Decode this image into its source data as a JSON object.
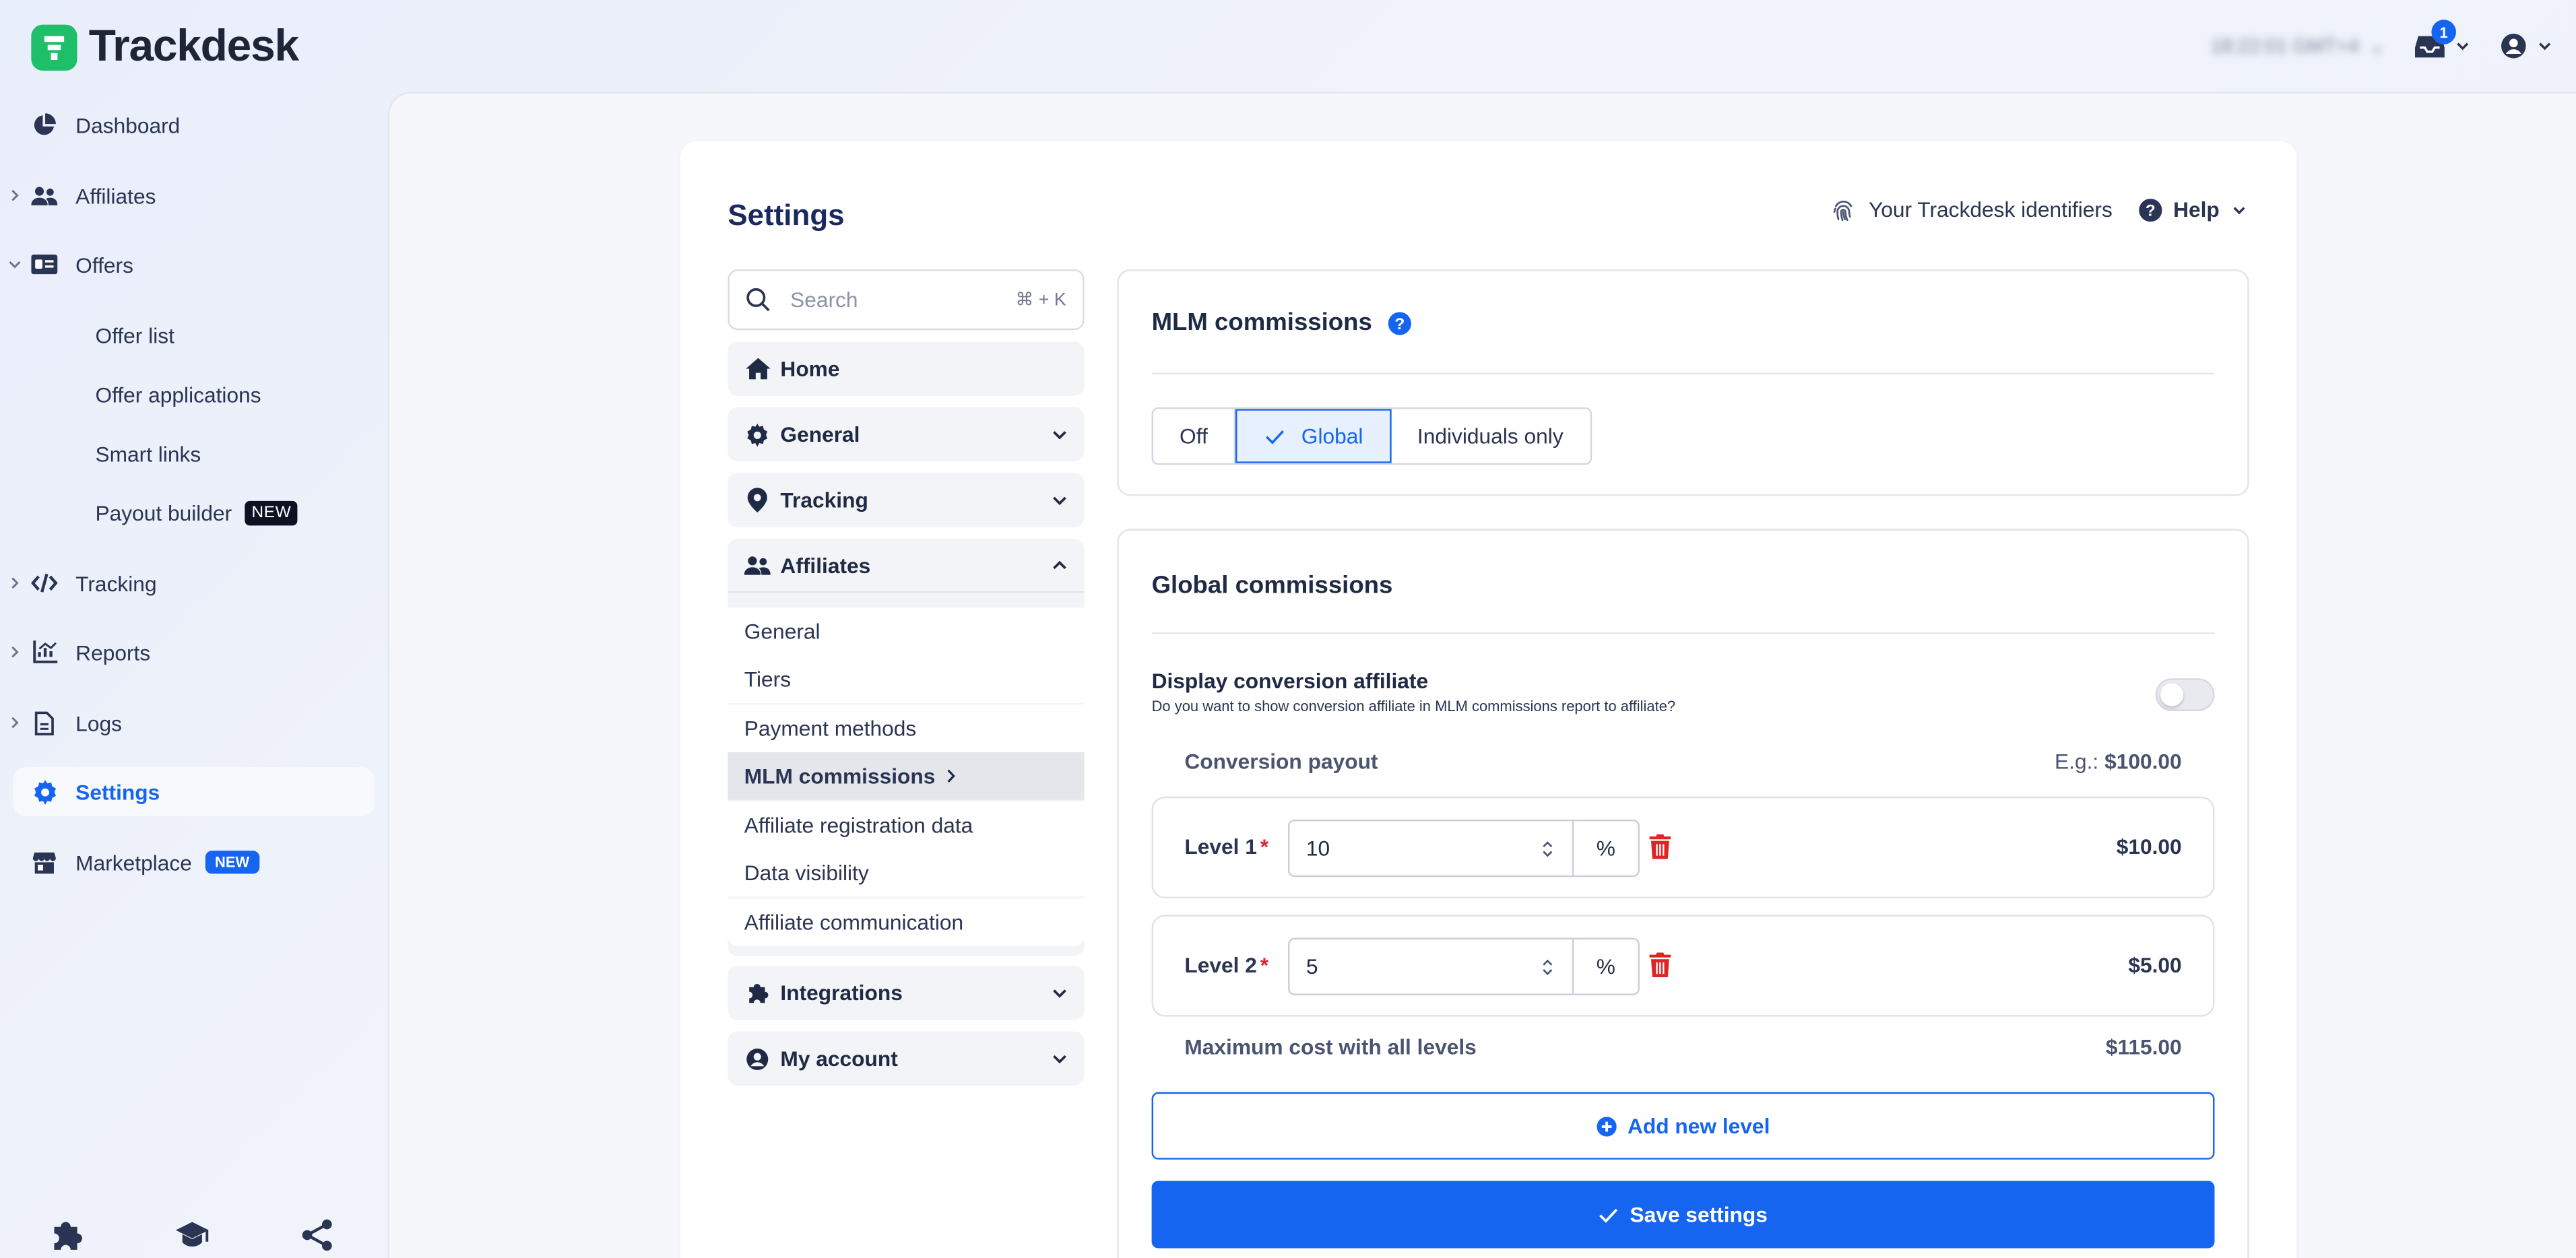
{
  "brand": {
    "name": "Trackdesk",
    "accent": "#1565f0",
    "logo_color": "#1fbf6a"
  },
  "topbar": {
    "clock": "18:22:01 GMT+4",
    "notification_count": "1"
  },
  "sidebar": {
    "items": [
      {
        "label": "Dashboard",
        "icon": "pie-chart-icon"
      },
      {
        "label": "Affiliates",
        "icon": "users-icon"
      },
      {
        "label": "Offers",
        "icon": "id-card-icon"
      },
      {
        "label": "Tracking",
        "icon": "code-icon"
      },
      {
        "label": "Reports",
        "icon": "chart-icon"
      },
      {
        "label": "Logs",
        "icon": "file-icon"
      },
      {
        "label": "Settings",
        "icon": "gear-icon"
      },
      {
        "label": "Marketplace",
        "icon": "store-icon",
        "badge": "NEW"
      }
    ],
    "offers_sub": [
      {
        "label": "Offer list"
      },
      {
        "label": "Offer applications"
      },
      {
        "label": "Smart links"
      },
      {
        "label": "Payout builder",
        "badge": "NEW"
      }
    ]
  },
  "settings": {
    "title": "Settings",
    "identifiers_label": "Your Trackdesk identifiers",
    "help_label": "Help",
    "search": {
      "placeholder": "Search",
      "shortcut": "⌘ + K"
    },
    "nav": {
      "home": "Home",
      "general": "General",
      "tracking": "Tracking",
      "affiliates": "Affiliates",
      "affiliates_sub": [
        "General",
        "Tiers",
        "Payment methods",
        "MLM commissions",
        "Affiliate registration data",
        "Data visibility",
        "Affiliate communication"
      ],
      "integrations": "Integrations",
      "my_account": "My account"
    }
  },
  "mlm": {
    "title": "MLM commissions",
    "modes": [
      "Off",
      "Global",
      "Individuals only"
    ],
    "selected_mode": "Global"
  },
  "global": {
    "title": "Global commissions",
    "toggle_title": "Display conversion affiliate",
    "toggle_desc": "Do you want to show conversion affiliate in MLM commissions report to affiliate?",
    "toggle_on": false,
    "payout_label": "Conversion payout",
    "payout_example_prefix": "E.g.:",
    "payout_example_value": "$100.00",
    "levels": [
      {
        "label": "Level 1",
        "value": "10",
        "unit": "%",
        "amount": "$10.00"
      },
      {
        "label": "Level 2",
        "value": "5",
        "unit": "%",
        "amount": "$5.00"
      }
    ],
    "max_label": "Maximum cost with all levels",
    "max_value": "$115.00",
    "add_level": "Add new level",
    "save": "Save settings"
  }
}
